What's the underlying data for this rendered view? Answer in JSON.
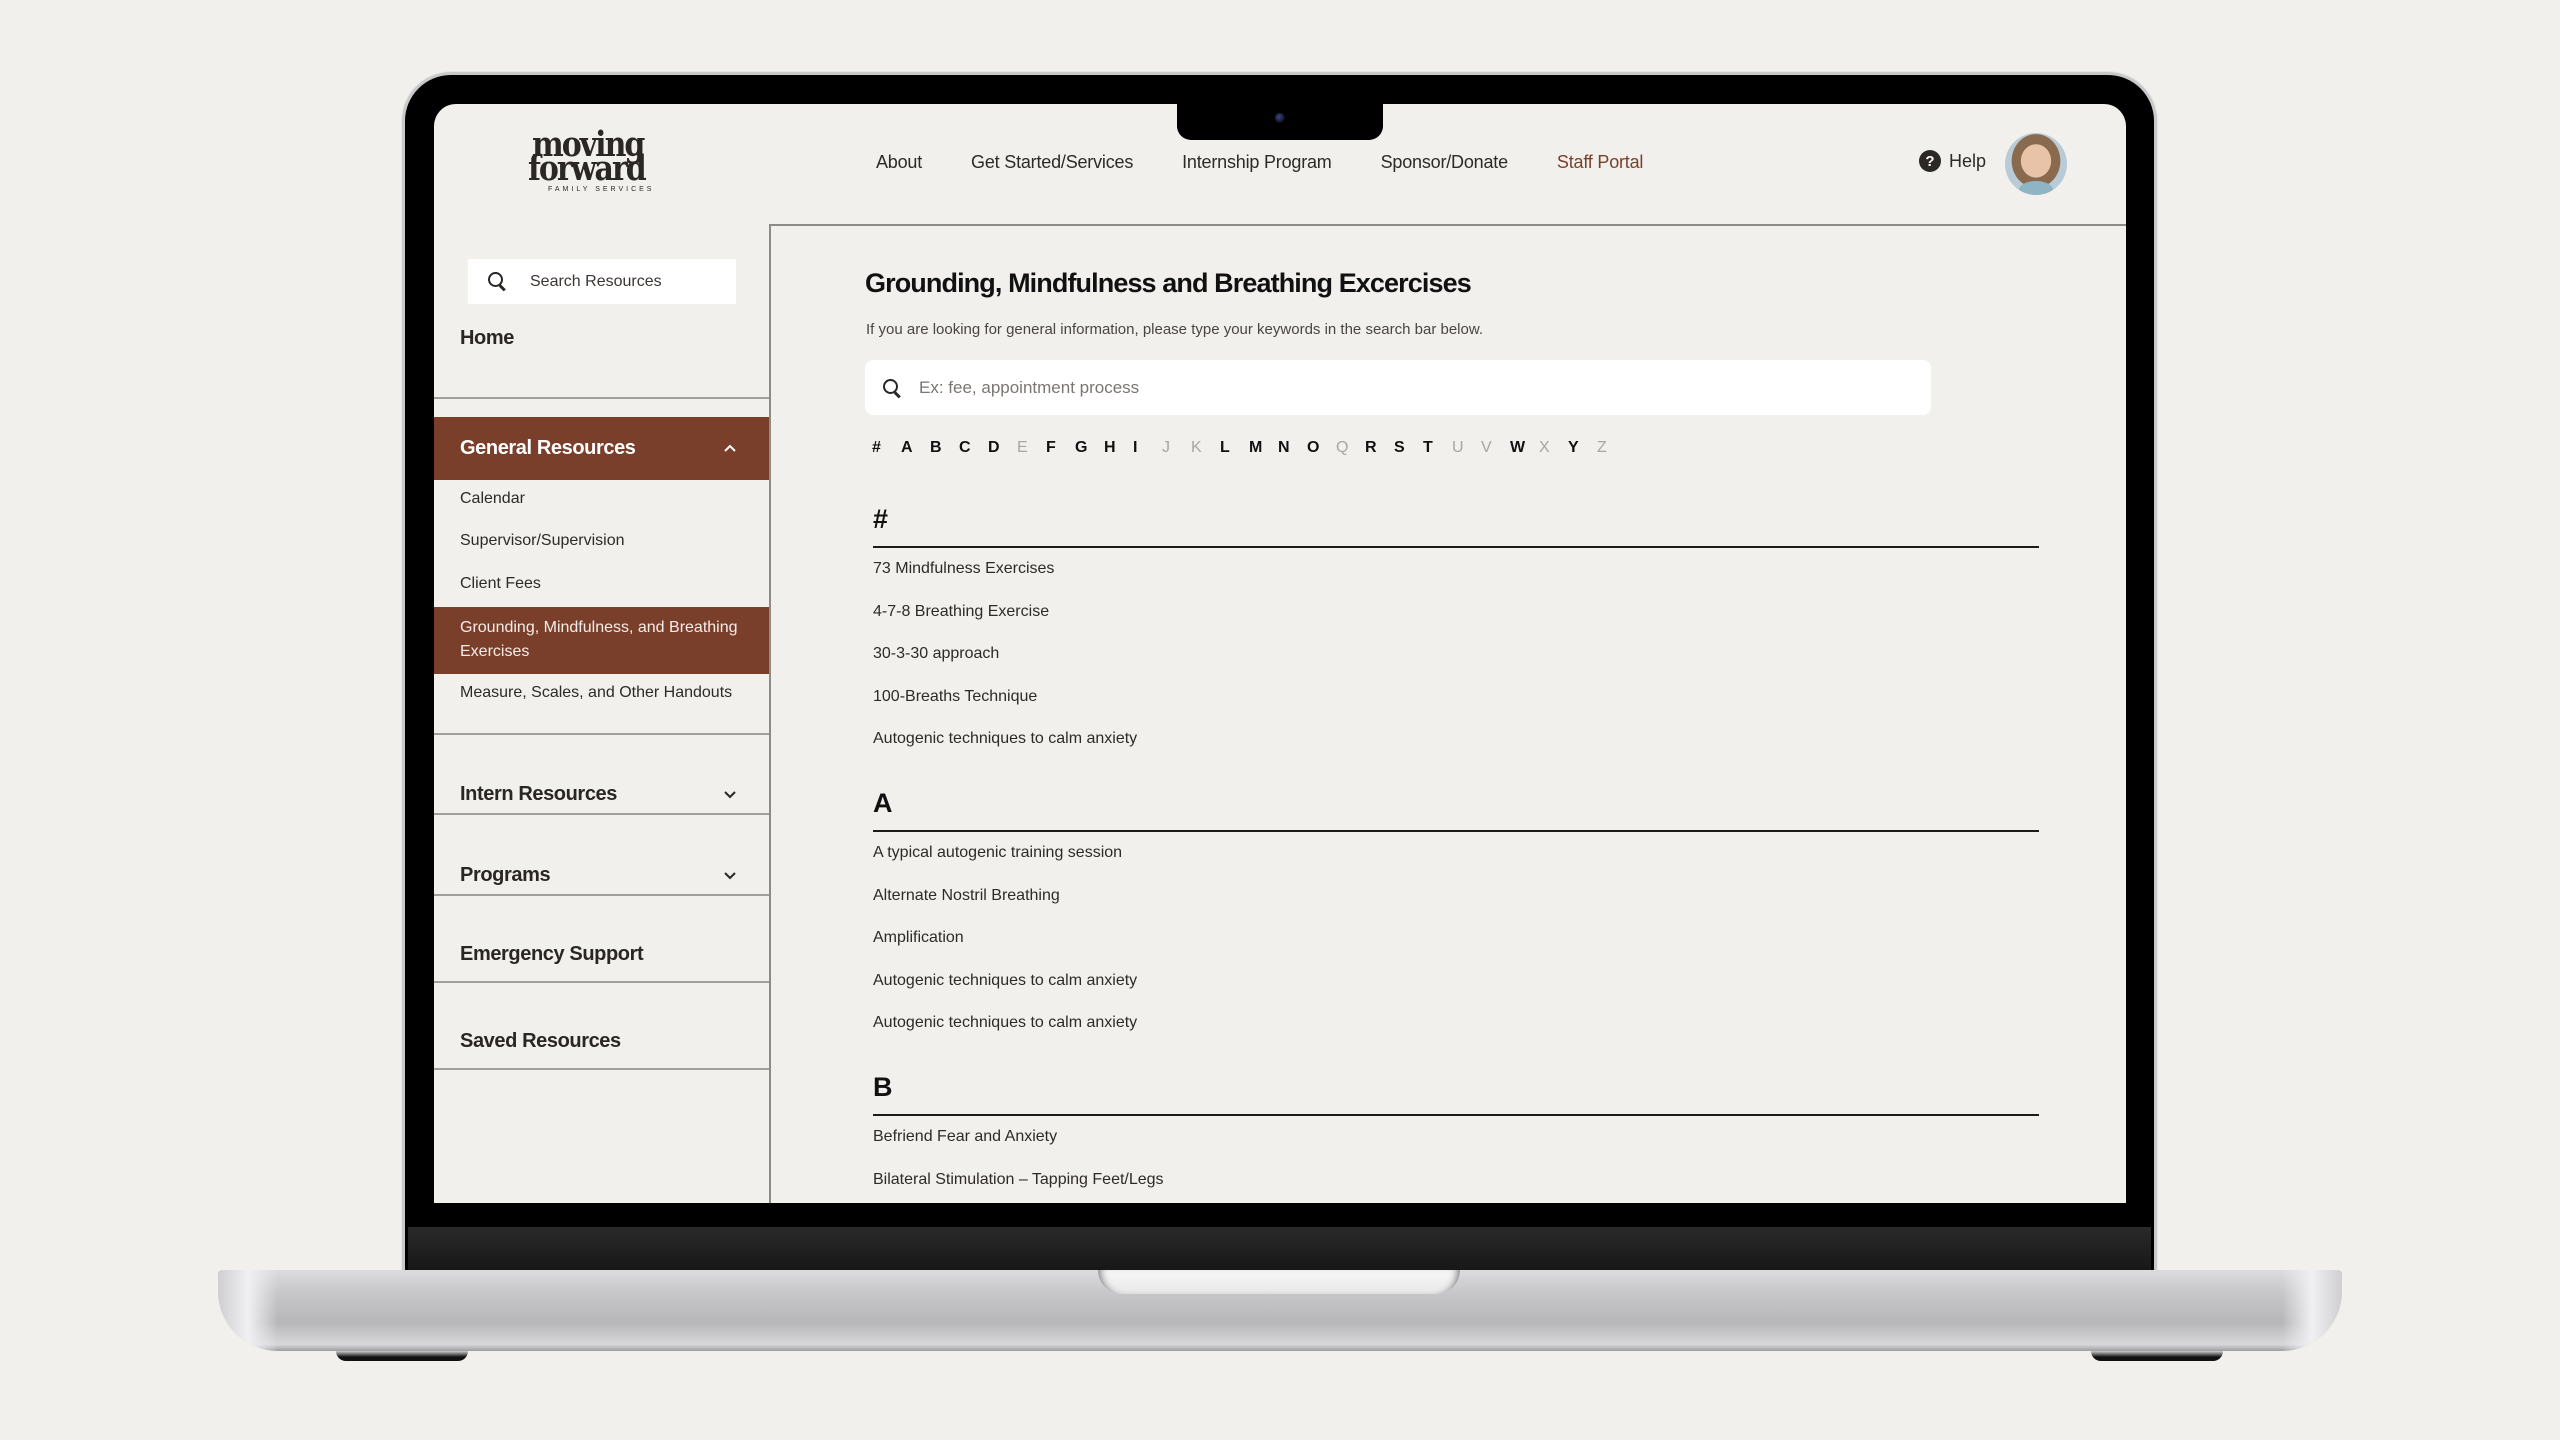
{
  "brand": {
    "logo_line1": "moving",
    "logo_line2": "forward",
    "logo_tagline": "FAMILY SERVICES"
  },
  "nav": {
    "items": [
      "About",
      "Get Started/Services",
      "Internship Program",
      "Sponsor/Donate",
      "Staff Portal"
    ],
    "help_label": "Help",
    "accent_color": "#7a3f2b"
  },
  "sidebar": {
    "search_placeholder": "Search Resources",
    "home": "Home",
    "general_resources": {
      "label": "General Resources",
      "expanded": true,
      "items": [
        "Calendar",
        "Supervisor/Supervision",
        "Client Fees",
        "Grounding, Mindfulness, and Breathing Exercises",
        "Measure, Scales, and Other Handouts"
      ],
      "selected_index": 3
    },
    "intern_resources": "Intern Resources",
    "programs": "Programs",
    "emergency_support": "Emergency Support",
    "saved_resources": "Saved Resources"
  },
  "main": {
    "title": "Grounding, Mindfulness and Breathing Excercises",
    "subtitle": "If you are looking for general information, please type your keywords in the search bar below.",
    "search_placeholder": "Ex: fee, appointment process",
    "alphabet": [
      {
        "letter": "#",
        "enabled": true
      },
      {
        "letter": "A",
        "enabled": true
      },
      {
        "letter": "B",
        "enabled": true
      },
      {
        "letter": "C",
        "enabled": true
      },
      {
        "letter": "D",
        "enabled": true
      },
      {
        "letter": "E",
        "enabled": false
      },
      {
        "letter": "F",
        "enabled": true
      },
      {
        "letter": "G",
        "enabled": true
      },
      {
        "letter": "H",
        "enabled": true
      },
      {
        "letter": "I",
        "enabled": true
      },
      {
        "letter": "J",
        "enabled": false
      },
      {
        "letter": "K",
        "enabled": false
      },
      {
        "letter": "L",
        "enabled": true
      },
      {
        "letter": "M",
        "enabled": true
      },
      {
        "letter": "N",
        "enabled": true
      },
      {
        "letter": "O",
        "enabled": true
      },
      {
        "letter": "Q",
        "enabled": false
      },
      {
        "letter": "R",
        "enabled": true
      },
      {
        "letter": "S",
        "enabled": true
      },
      {
        "letter": "T",
        "enabled": true
      },
      {
        "letter": "U",
        "enabled": false
      },
      {
        "letter": "V",
        "enabled": false
      },
      {
        "letter": "W",
        "enabled": true
      },
      {
        "letter": "X",
        "enabled": false
      },
      {
        "letter": "Y",
        "enabled": true
      },
      {
        "letter": "Z",
        "enabled": false
      }
    ],
    "groups": [
      {
        "heading": "#",
        "entries": [
          "73 Mindfulness Exercises",
          "4-7-8 Breathing Exercise",
          "30-3-30 approach",
          "100-Breaths Technique",
          "Autogenic techniques to calm anxiety"
        ]
      },
      {
        "heading": "A",
        "entries": [
          "A typical autogenic training session",
          "Alternate Nostril Breathing",
          "Amplification",
          "Autogenic techniques to calm anxiety",
          "Autogenic techniques to calm anxiety"
        ]
      },
      {
        "heading": "B",
        "entries": [
          "Befriend Fear and Anxiety",
          "Bilateral Stimulation – Tapping Feet/Legs"
        ]
      }
    ]
  }
}
